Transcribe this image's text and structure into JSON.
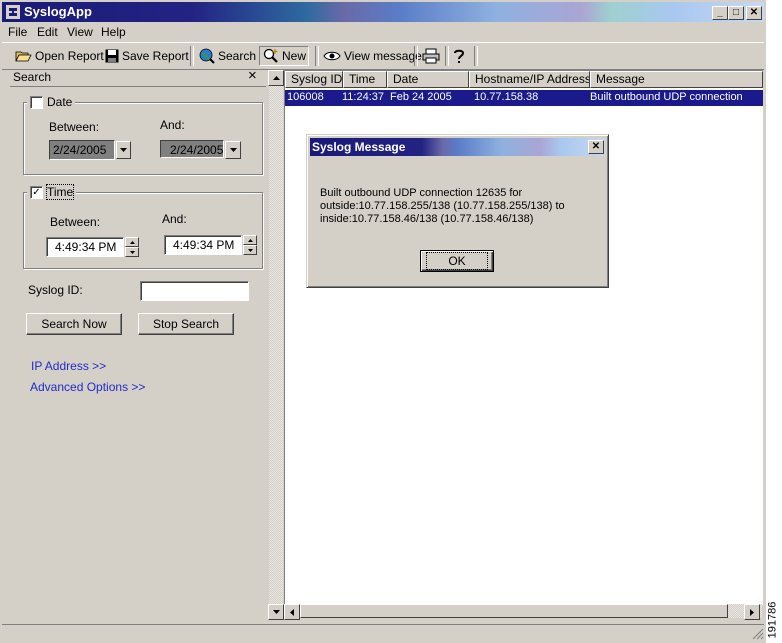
{
  "window": {
    "title": "SyslogApp",
    "minimize": "_",
    "maximize": "□",
    "close": "✕"
  },
  "menu": [
    {
      "label": "File"
    },
    {
      "label": "Edit"
    },
    {
      "label": "View"
    },
    {
      "label": "Help"
    }
  ],
  "toolbar": {
    "open_report": "Open Report",
    "save_report": "Save Report",
    "search": "Search",
    "new": "New",
    "view_message": "View message"
  },
  "search_panel": {
    "title": "Search",
    "close": "×",
    "date": {
      "label": "Date",
      "checked": false,
      "between_label": "Between:",
      "and_label": "And:",
      "between_value": "2/24/2005",
      "and_value": "2/24/2005"
    },
    "time": {
      "label": "Time",
      "checked": true,
      "between_label": "Between:",
      "and_label": "And:",
      "between_value": "4:49:34 PM",
      "and_value": "4:49:34 PM"
    },
    "syslog_id_label": "Syslog ID:",
    "syslog_id_value": "",
    "search_now": "Search Now",
    "stop_search": "Stop Search",
    "ip_address_link": "IP Address >>",
    "advanced_options_link": "Advanced Options >>"
  },
  "list": {
    "columns": [
      "Syslog ID",
      "Time",
      "Date",
      "Hostname/IP Address",
      "Message"
    ],
    "rows": [
      {
        "syslog_id": "106008",
        "time": "11:24:37",
        "date": "Feb 24 2005",
        "host": "10.77.158.38",
        "message": "Built outbound UDP connection"
      }
    ]
  },
  "dialog": {
    "title": "Syslog Message",
    "close": "✕",
    "lines": [
      "Built outbound UDP connection 12635 for",
      "outside:10.77.158.255/138 (10.77.158.255/138) to",
      "inside:10.77.158.46/138 (10.77.158.46/138)"
    ],
    "ok": "OK"
  },
  "side_note": "191786"
}
